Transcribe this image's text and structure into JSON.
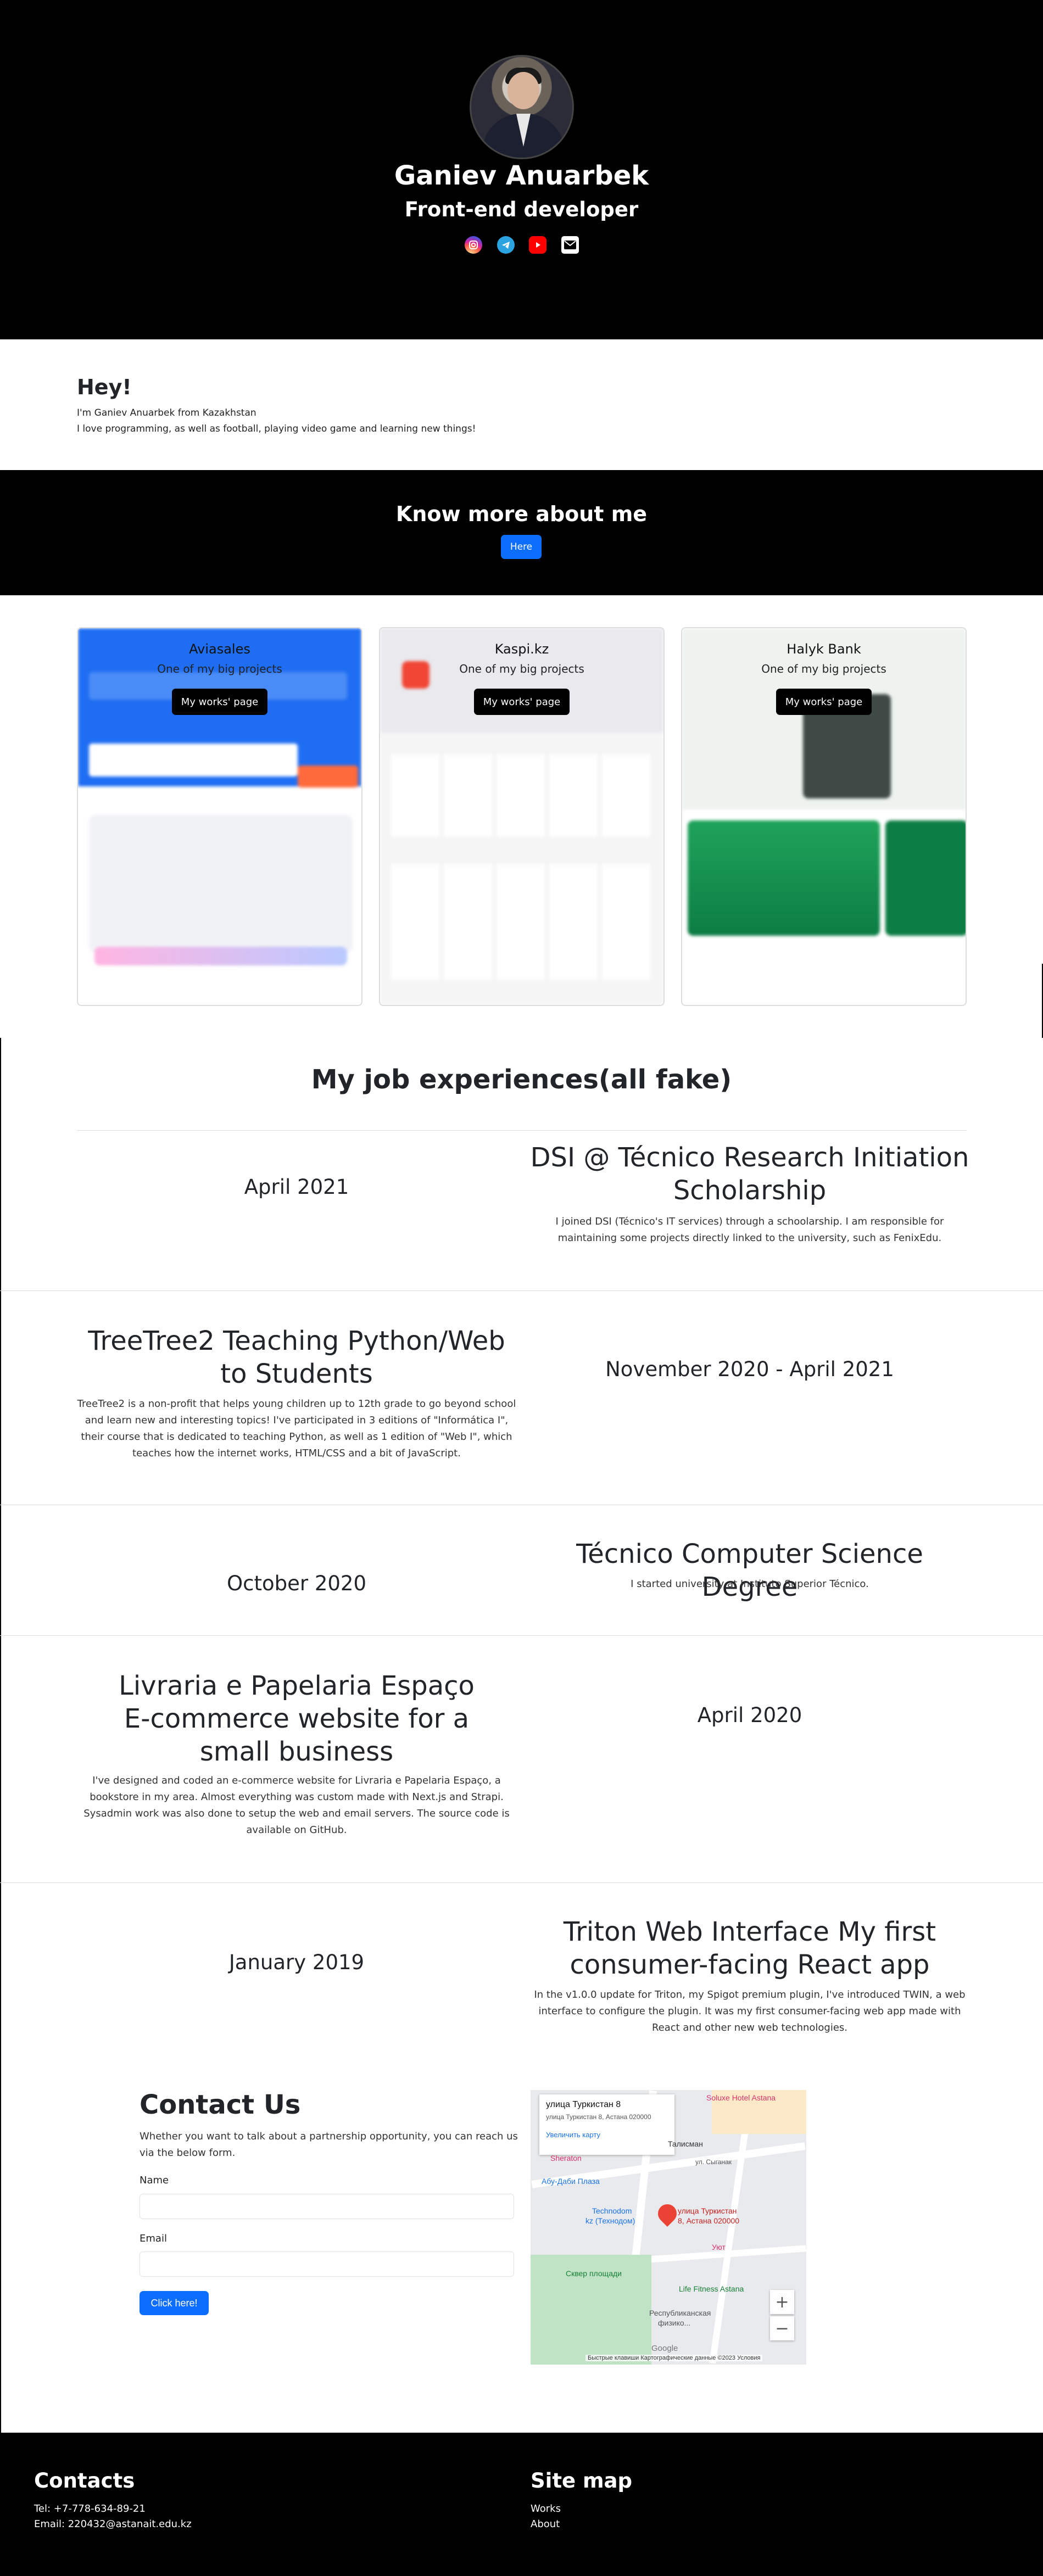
{
  "hero": {
    "name": "Ganiev Anuarbek",
    "role": "Front-end developer",
    "socials": [
      {
        "icon": "instagram-icon"
      },
      {
        "icon": "telegram-icon"
      },
      {
        "icon": "youtube-icon"
      },
      {
        "icon": "mail-icon"
      }
    ]
  },
  "intro": {
    "title": "Hey!",
    "line1": "I'm Ganiev Anuarbek from Kazakhstan",
    "line2": "I love programming, as well as football, playing video game and learning new things!"
  },
  "know_more": {
    "title": "Know more about me",
    "button": "Here"
  },
  "works": [
    {
      "title": "Aviasales",
      "subtitle": "One of my big projects",
      "button": "My works' page"
    },
    {
      "title": "Kaspi.kz",
      "subtitle": "One of my big projects",
      "button": "My works' page"
    },
    {
      "title": "Halyk Bank",
      "subtitle": "One of my big projects",
      "button": "My works' page"
    }
  ],
  "jobs": {
    "title": "My job experiences(all fake)",
    "items": [
      {
        "date": "April 2021",
        "title": "DSI @ Técnico Research Initiation Scholarship",
        "desc": "I joined DSI (Técnico's IT services) through a schoolarship. I am responsible for maintaining some projects directly linked to the university, such as FenixEdu."
      },
      {
        "date": "November 2020 - April 2021",
        "title": "TreeTree2 Teaching Python/Web to Students",
        "desc": "TreeTree2 is a non-profit that helps young children up to 12th grade to go beyond school and learn new and interesting topics! I've participated in 3 editions of \"Informática I\", their course that is dedicated to teaching Python, as well as 1 edition of \"Web I\", which teaches how the internet works, HTML/CSS and a bit of JavaScript."
      },
      {
        "date": "October 2020",
        "title": "Técnico Computer Science Degree",
        "desc": "I started university at Instituto Superior Técnico."
      },
      {
        "date": "April 2020",
        "title": "Livraria e Papelaria Espaço E-commerce website for a small business",
        "desc": "I've designed and coded an e-commerce website for Livraria e Papelaria Espaço, a bookstore in my area. Almost everything was custom made with Next.js and Strapi. Sysadmin work was also done to setup the web and email servers. The source code is available on GitHub."
      },
      {
        "date": "January 2019",
        "title": "Triton Web Interface My first consumer-facing React app",
        "desc": "In the v1.0.0 update for Triton, my Spigot premium plugin, I've introduced TWIN, a web interface to configure the plugin. It was my first consumer-facing web app made with React and other new web technologies."
      }
    ]
  },
  "contact": {
    "title": "Contact Us",
    "text": "Whether you want to talk about a partnership opportunity, you can reach us via the below form.",
    "name_label": "Name",
    "name_value": "",
    "email_label": "Email",
    "email_value": "",
    "button": "Click here!"
  },
  "map": {
    "popup_title": "улица Туркистан 8",
    "popup_address": "улица Туркистан 8, Астана 020000",
    "popup_link": "Увеличить карту",
    "labels": {
      "hotel": "Soluxe Hotel Astana",
      "sheraton": "Sheraton",
      "talisman": "Талисман",
      "street": "ул. Сыганак",
      "plaza": "Абу-Даби Плаза",
      "technodom": "Technodom",
      "technodom_sub": "kz (Технодом)",
      "pin_label": "улица Туркистан",
      "pin_sub": "8, Астана 020000",
      "uyut": "Уют",
      "square": "Сквер площади",
      "fitness": "Life Fitness Astana",
      "school": "Республиканская",
      "school_sub": "физико..."
    },
    "zoom_in": "+",
    "zoom_out": "−",
    "google": "Google",
    "footer": "Быстрые клавиши   Картографические данные ©2023   Условия"
  },
  "footer": {
    "contacts_title": "Contacts",
    "tel": "Tel: +7-778-634-89-21",
    "email": "Email: 220432@astanait.edu.kz",
    "sitemap_title": "Site map",
    "link_works": "Works",
    "link_about": "About"
  },
  "colors": {
    "accent": "#0d6efd",
    "dark": "#000000"
  }
}
